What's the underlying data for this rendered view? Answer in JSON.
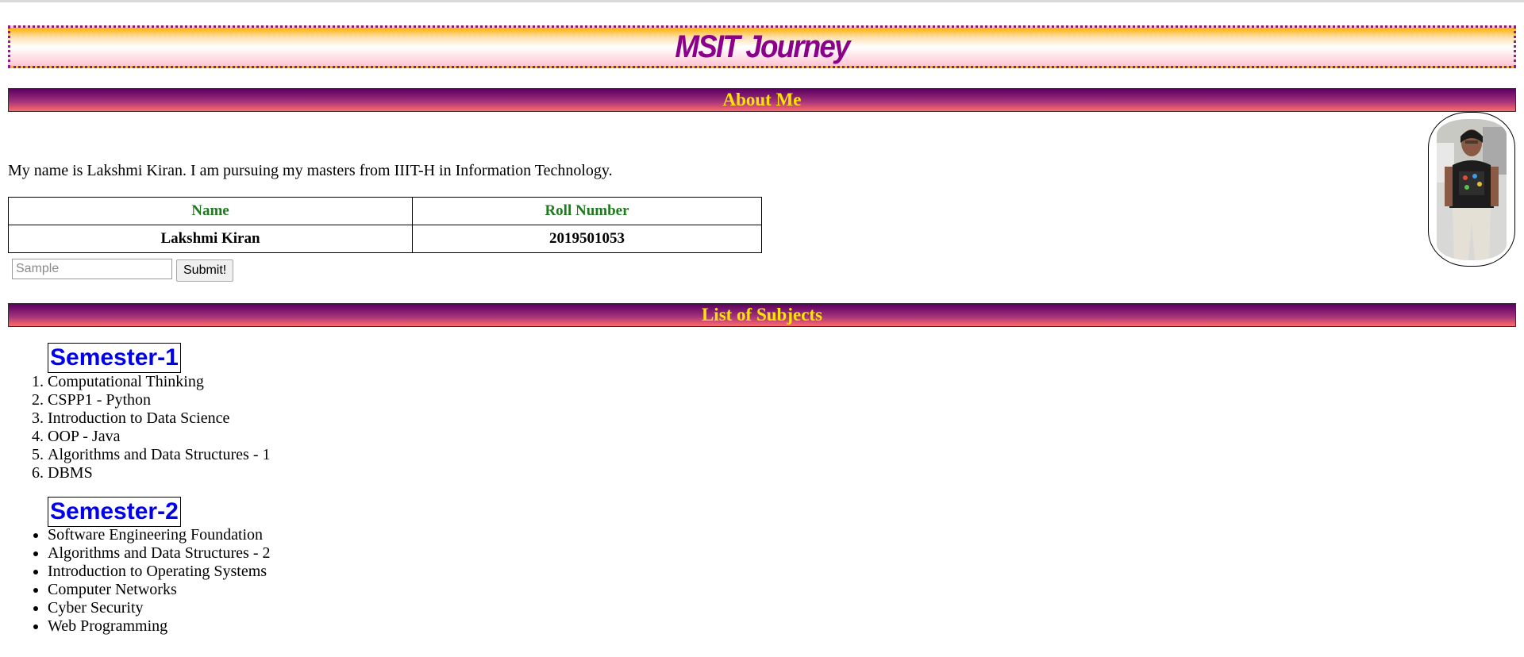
{
  "page": {
    "banner_title": "MSIT Journey"
  },
  "about": {
    "heading": "About Me",
    "intro": "My name is Lakshmi Kiran. I am pursuing my masters from IIIT-H in Information Technology.",
    "table": {
      "headers": [
        "Name",
        "Roll Number"
      ],
      "row": [
        "Lakshmi Kiran",
        "2019501053"
      ]
    },
    "form": {
      "input_placeholder": "Sample",
      "input_value": "",
      "submit_label": "Submit!"
    }
  },
  "subjects": {
    "heading": "List of Subjects",
    "semesters": [
      {
        "title": "Semester-1",
        "items": [
          "Computational Thinking",
          "CSPP1 - Python",
          "Introduction to Data Science",
          "OOP - Java",
          "Algorithms and Data Structures - 1",
          "DBMS"
        ]
      },
      {
        "title": "Semester-2",
        "items": [
          "Software Engineering Foundation",
          "Algorithms and Data Structures - 2",
          "Introduction to Operating Systems",
          "Computer Networks",
          "Cyber Security",
          "Web Programming"
        ]
      }
    ]
  },
  "colors": {
    "banner_border": "#8b1a8b",
    "banner_title": "#8b008b",
    "section_text": "#ffe600",
    "table_header_text": "#1f7a1f",
    "semester_heading": "#0000ee"
  }
}
